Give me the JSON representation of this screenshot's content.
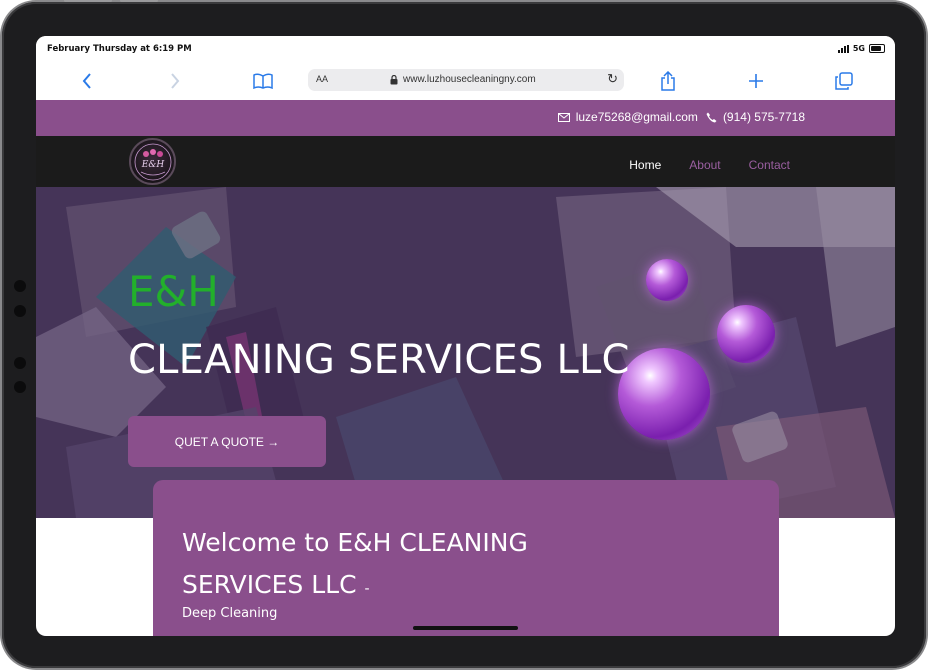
{
  "status_bar": {
    "time": "February Thursday at 6:19 PM",
    "network": "5G"
  },
  "browser": {
    "reader_label": "AA",
    "url": "www.luzhousecleaningny.com",
    "accent_color": "#2a7ae8"
  },
  "contact": {
    "email": "luze75268@gmail.com",
    "phone": "(914) 575-7718",
    "bar_color": "#8a4f8c"
  },
  "nav": {
    "logo_text": "E&H",
    "items": [
      {
        "label": "Home",
        "active": true
      },
      {
        "label": "About",
        "active": false
      },
      {
        "label": "Contact",
        "active": false
      }
    ]
  },
  "hero": {
    "title_small": "E&H",
    "title_big": "CLEANING SERVICES LLC",
    "cta_label": "QUET A QUOTE →",
    "title_small_color": "#22b02b"
  },
  "welcome": {
    "title": "Welcome to  E&H CLEANING SERVICES LLC",
    "dash": "-",
    "subtitle": "Deep Cleaning"
  }
}
